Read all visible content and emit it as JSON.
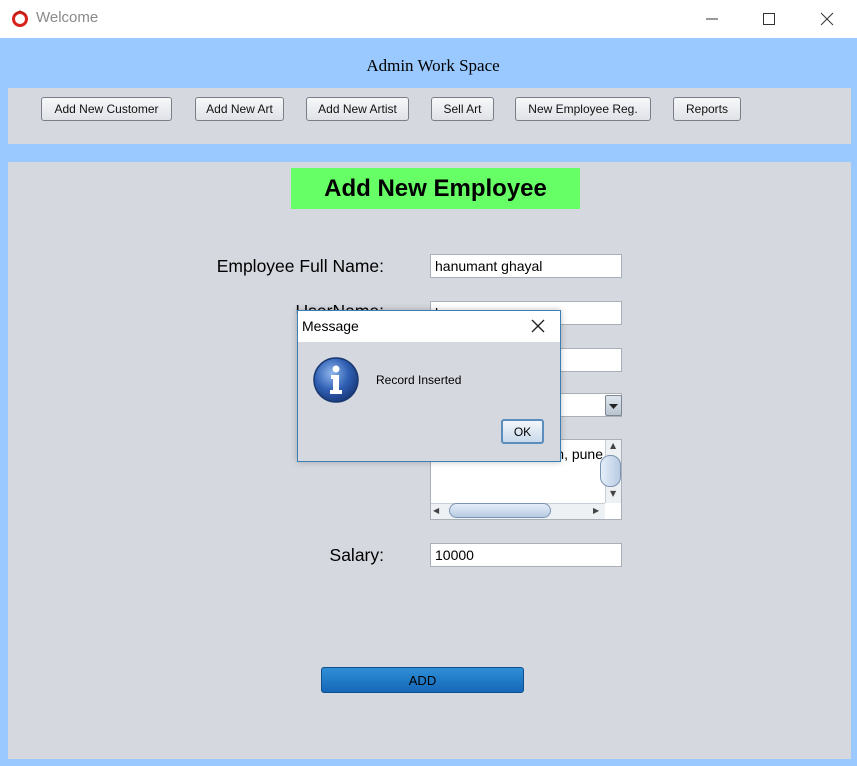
{
  "window": {
    "title": "Welcome",
    "icon": "app-ring-icon",
    "controls": [
      "minimize-icon",
      "maximize-icon",
      "close-icon"
    ]
  },
  "header": {
    "workspace_title": "Admin Work Space"
  },
  "nav": {
    "buttons": [
      {
        "label": "Add New Customer"
      },
      {
        "label": "Add New Art"
      },
      {
        "label": "Add New Artist"
      },
      {
        "label": "Sell Art"
      },
      {
        "label": "New Employee Reg."
      },
      {
        "label": "Reports"
      }
    ]
  },
  "form": {
    "heading": "Add New Employee",
    "heading_color": "#66ff66",
    "fields": {
      "full_name": {
        "label": "Employee Full Name:",
        "value": "hanumant ghayal"
      },
      "username": {
        "label": "UserName:",
        "value": "h"
      },
      "address": {
        "value": "garh,  pune"
      },
      "salary": {
        "label": "Salary:",
        "value": "10000"
      }
    },
    "add_button": "ADD"
  },
  "dialog": {
    "title": "Message",
    "icon": "info-icon",
    "message": "Record Inserted",
    "ok_label": "OK"
  },
  "colors": {
    "frame": "#99c9ff",
    "panel": "#d5d8df",
    "add_button": "#1f7cc8"
  }
}
